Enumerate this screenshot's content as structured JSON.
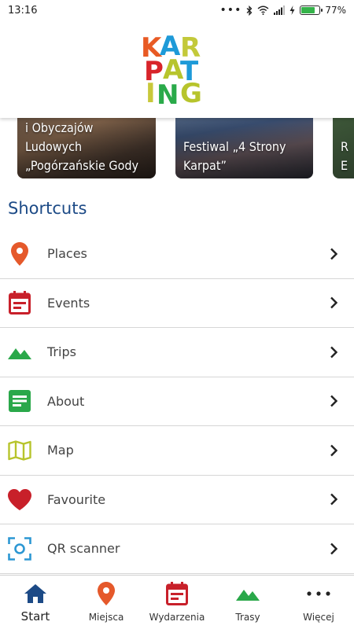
{
  "status_bar": {
    "time": "13:16",
    "battery_percent": "77%",
    "battery_level": 0.77,
    "icons": [
      "more-dots-icon",
      "bluetooth-icon",
      "wifi-icon",
      "signal-icon",
      "charging-icon",
      "battery-icon"
    ]
  },
  "header": {
    "logo_text": "KARPATING",
    "logo_colors": [
      "#e85a24",
      "#1e9ad8",
      "#c3c93a",
      "#d8242a",
      "#2aaa4a",
      "#1e3d7a"
    ]
  },
  "carousel": {
    "cards": [
      {
        "title": "i Obyczajów\nLudowych\n„Pogórzańskie Gody"
      },
      {
        "title": "Festiwal „4 Strony\nKarpat”"
      },
      {
        "title": "R\nE"
      }
    ]
  },
  "shortcuts": {
    "title": "Shortcuts",
    "items": [
      {
        "label": "Places",
        "icon": "map-pin-icon",
        "color": "#e5592b"
      },
      {
        "label": "Events",
        "icon": "calendar-icon",
        "color": "#c8202a"
      },
      {
        "label": "Trips",
        "icon": "mountains-icon",
        "color": "#2aa84a"
      },
      {
        "label": "About",
        "icon": "document-icon",
        "color": "#2aa84a"
      },
      {
        "label": "Map",
        "icon": "folded-map-icon",
        "color": "#b7c42c"
      },
      {
        "label": "Favourite",
        "icon": "heart-icon",
        "color": "#c8202a"
      },
      {
        "label": "QR scanner",
        "icon": "qr-scan-icon",
        "color": "#2c97d3"
      }
    ]
  },
  "bottom_nav": {
    "items": [
      {
        "label": "Start",
        "icon": "home-icon",
        "color": "#1c4a86"
      },
      {
        "label": "Miejsca",
        "icon": "map-pin-icon",
        "color": "#e5592b"
      },
      {
        "label": "Wydarzenia",
        "icon": "calendar-icon",
        "color": "#c8202a"
      },
      {
        "label": "Trasy",
        "icon": "mountains-icon",
        "color": "#2aa84a"
      },
      {
        "label": "Więcej",
        "icon": "more-dots-icon",
        "color": "#222222"
      }
    ]
  }
}
